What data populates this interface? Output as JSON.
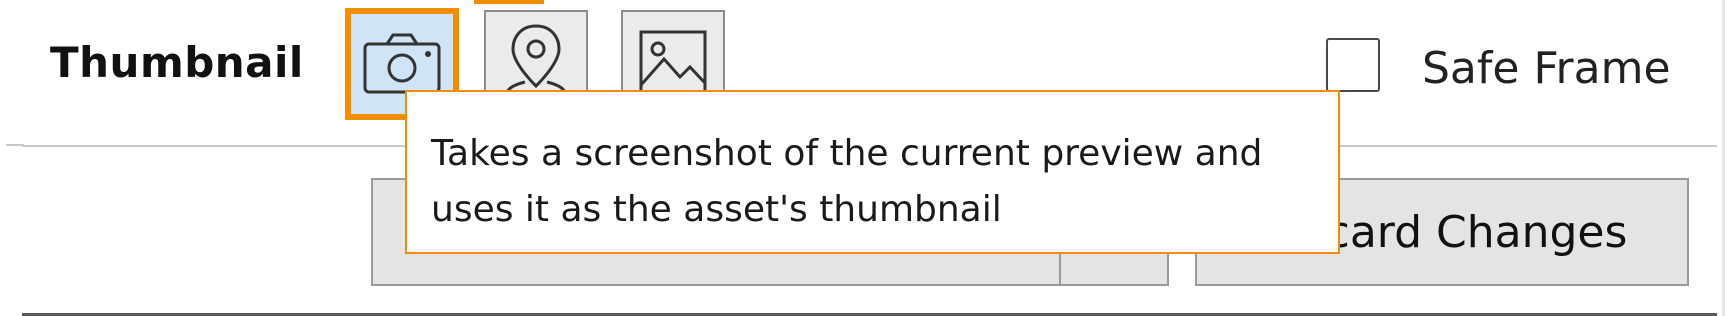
{
  "thumbnail": {
    "label": "Thumbnail",
    "tools": [
      {
        "icon": "camera-icon",
        "active": true
      },
      {
        "icon": "map-pin-icon",
        "active": false
      },
      {
        "icon": "image-icon",
        "active": false
      }
    ]
  },
  "safe_frame": {
    "label": "Safe Frame",
    "checked": false
  },
  "actions": {
    "discard_label": "Discard Changes"
  },
  "tooltip": {
    "line1": "Takes a screenshot of the current preview and",
    "line2": "uses it as the asset's thumbnail"
  },
  "colors": {
    "accent": "#f28c00",
    "active_bg": "#cfe4f7"
  }
}
